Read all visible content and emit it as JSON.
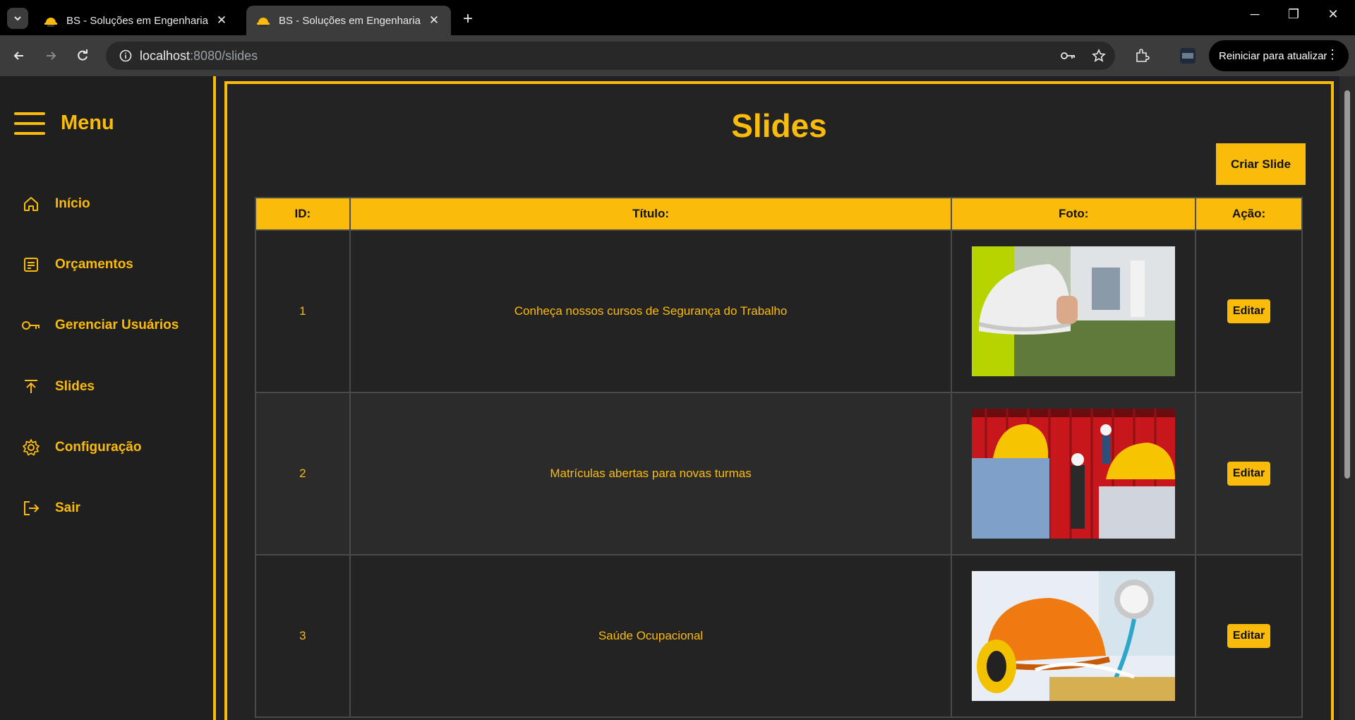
{
  "browser": {
    "tabs": [
      {
        "title": "BS - Soluções em Engenharia e",
        "active": false
      },
      {
        "title": "BS - Soluções em Engenharia e",
        "active": true
      }
    ],
    "url_host": "localhost",
    "url_rest": ":8080/slides",
    "restart_label": "Reiniciar para atualizar"
  },
  "sidebar": {
    "menu_label": "Menu",
    "items": [
      {
        "label": "Início",
        "icon": "home-icon"
      },
      {
        "label": "Orçamentos",
        "icon": "document-icon"
      },
      {
        "label": "Gerenciar Usuários",
        "icon": "key-icon"
      },
      {
        "label": "Slides",
        "icon": "upload-icon"
      },
      {
        "label": "Configuração",
        "icon": "gear-icon"
      },
      {
        "label": "Sair",
        "icon": "logout-icon"
      }
    ]
  },
  "main": {
    "title": "Slides",
    "create_button": "Criar Slide",
    "table": {
      "headers": [
        "ID:",
        "Título:",
        "Foto:",
        "Ação:"
      ],
      "rows": [
        {
          "id": "1",
          "title": "Conheça nossos cursos de Segurança do Trabalho",
          "photo": "hard-hat-photo",
          "action": "Editar"
        },
        {
          "id": "2",
          "title": "Matrículas abertas para novas turmas",
          "photo": "workers-training-photo",
          "action": "Editar"
        },
        {
          "id": "3",
          "title": "Saúde Ocupacional",
          "photo": "occupational-health-photo",
          "action": "Editar"
        }
      ]
    }
  },
  "colors": {
    "accent": "#fbbb0a",
    "background": "#232323"
  }
}
